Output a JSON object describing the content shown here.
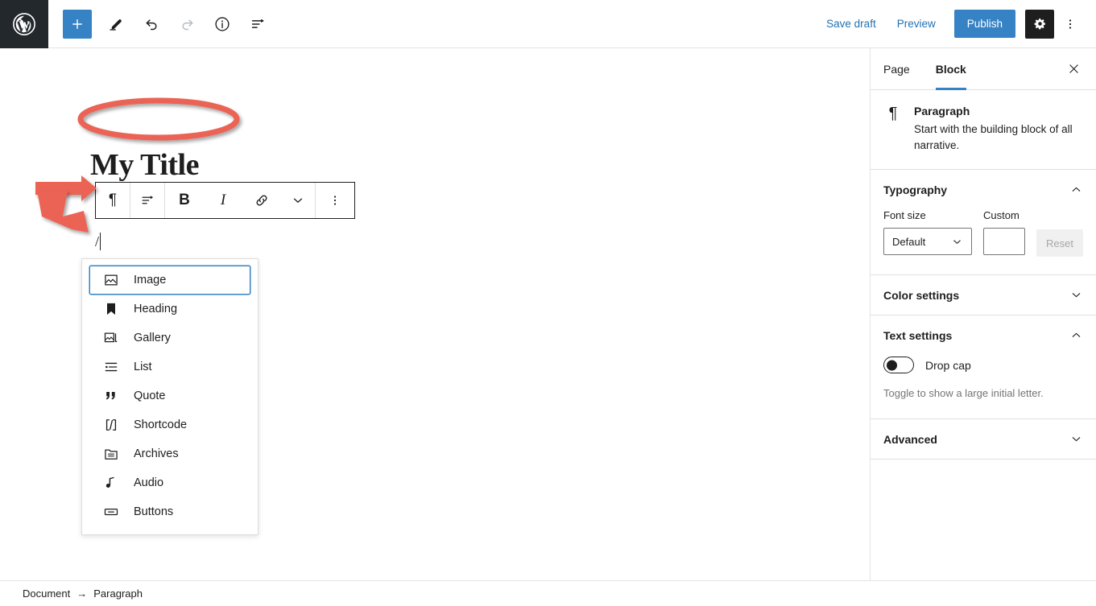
{
  "header": {
    "logo_icon": "wordpress-logo-icon",
    "tools": [
      {
        "name": "add-block-button",
        "icon": "plus-icon",
        "label": "+"
      },
      {
        "name": "edit-mode-button",
        "icon": "pencil-icon",
        "label": ""
      },
      {
        "name": "undo-button",
        "icon": "undo-arrow-icon",
        "label": ""
      },
      {
        "name": "redo-button",
        "icon": "redo-arrow-icon",
        "label": ""
      },
      {
        "name": "details-button",
        "icon": "info-circle-icon",
        "label": ""
      },
      {
        "name": "list-view-button",
        "icon": "list-view-icon",
        "label": ""
      }
    ],
    "save_draft_label": "Save draft",
    "preview_label": "Preview",
    "publish_label": "Publish",
    "settings_icon": "gear-icon",
    "more_icon": "kebab-vertical-icon"
  },
  "editor": {
    "post_title": "My Title",
    "paragraph_text": "/",
    "block_toolbar": [
      {
        "name": "block-type-button",
        "icon": "pilcrow-icon",
        "glyph": "¶"
      },
      {
        "name": "align-button",
        "icon": "align-left-icon",
        "glyph": ""
      },
      {
        "name": "bold-button",
        "icon": "bold-icon",
        "glyph": "B"
      },
      {
        "name": "italic-button",
        "icon": "italic-icon",
        "glyph": "I"
      },
      {
        "name": "link-button",
        "icon": "link-icon",
        "glyph": ""
      },
      {
        "name": "more-rich-text-button",
        "icon": "chevron-down-icon",
        "glyph": ""
      },
      {
        "name": "block-options-button",
        "icon": "kebab-vertical-icon",
        "glyph": ""
      }
    ]
  },
  "inserter": {
    "items": [
      {
        "label": "Image",
        "icon": "image-icon",
        "selected": true
      },
      {
        "label": "Heading",
        "icon": "heading-icon",
        "selected": false
      },
      {
        "label": "Gallery",
        "icon": "gallery-icon",
        "selected": false
      },
      {
        "label": "List",
        "icon": "list-icon",
        "selected": false
      },
      {
        "label": "Quote",
        "icon": "quote-icon",
        "selected": false
      },
      {
        "label": "Shortcode",
        "icon": "shortcode-icon",
        "selected": false
      },
      {
        "label": "Archives",
        "icon": "archives-icon",
        "selected": false
      },
      {
        "label": "Audio",
        "icon": "audio-icon",
        "selected": false
      },
      {
        "label": "Buttons",
        "icon": "buttons-icon",
        "selected": false
      }
    ]
  },
  "sidebar": {
    "tabs": [
      {
        "label": "Page",
        "active": false
      },
      {
        "label": "Block",
        "active": true
      }
    ],
    "close_icon": "close-icon",
    "block_card": {
      "icon": "pilcrow-icon",
      "glyph": "¶",
      "title": "Paragraph",
      "description": "Start with the building block of all narrative."
    },
    "panels": {
      "typography": {
        "title": "Typography",
        "expanded": true,
        "font_size_label": "Font size",
        "font_size_value": "Default",
        "custom_label": "Custom",
        "custom_value": "",
        "reset_label": "Reset"
      },
      "color_settings": {
        "title": "Color settings",
        "expanded": false
      },
      "text_settings": {
        "title": "Text settings",
        "expanded": true,
        "drop_cap_label": "Drop cap",
        "drop_cap_on": false,
        "drop_cap_help": "Toggle to show a large initial letter."
      },
      "advanced": {
        "title": "Advanced",
        "expanded": false
      }
    }
  },
  "footer": {
    "breadcrumb": [
      {
        "label": "Document"
      },
      {
        "label": "Paragraph"
      }
    ],
    "separator": "→"
  },
  "annotations": {
    "highlight_color": "#eb6454",
    "ellipse_target": "My Title",
    "arrow_1_target": "/",
    "arrow_2_target": "Image"
  },
  "colors": {
    "accent_blue": "#3582c4",
    "link_blue": "#2271b1",
    "dark_chrome": "#23282d",
    "text": "#1e1e1e",
    "muted": "#757575",
    "annotation_red": "#eb6454"
  }
}
